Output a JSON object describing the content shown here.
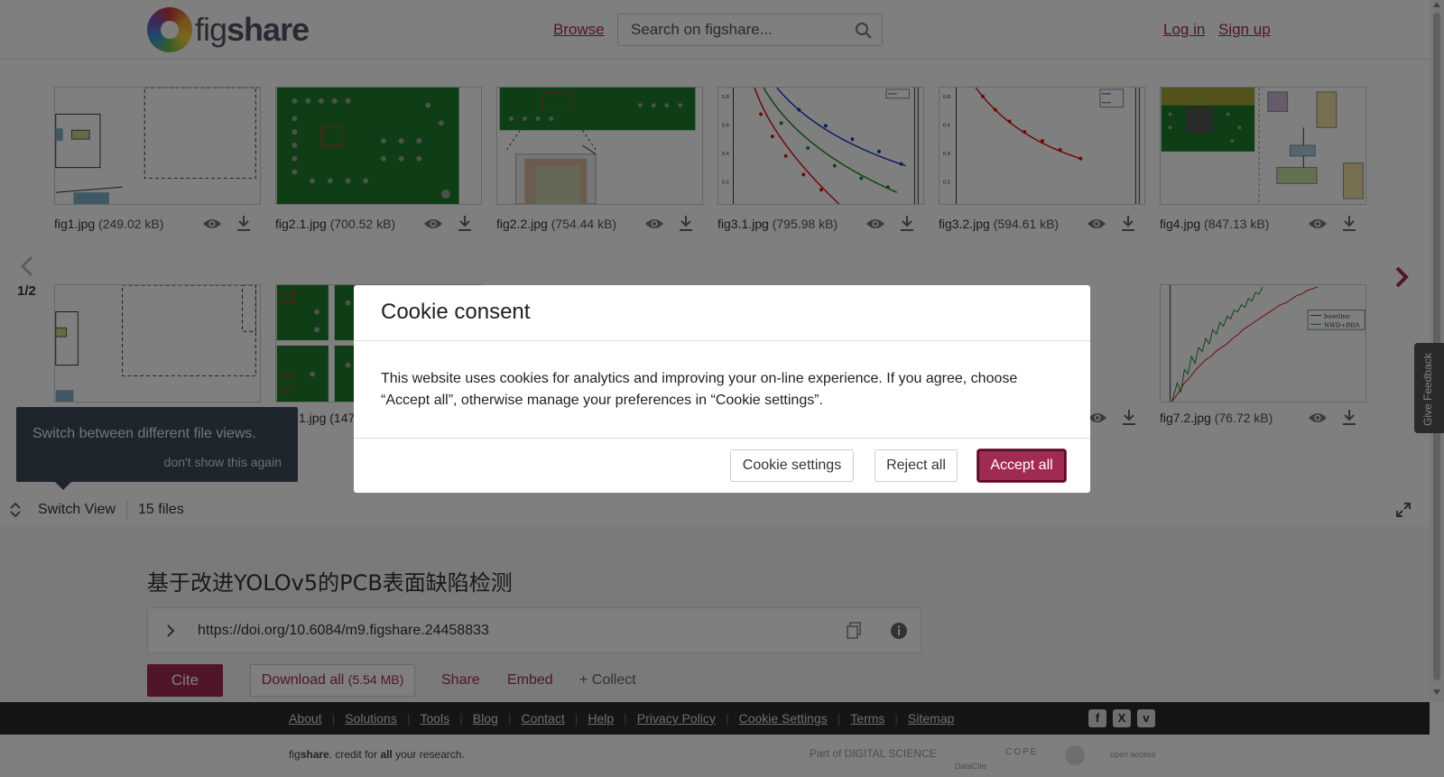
{
  "header": {
    "logo_text_a": "fig",
    "logo_text_b": "share",
    "browse": "Browse",
    "search_placeholder": "Search on figshare...",
    "login": "Log in",
    "signup": "Sign up"
  },
  "gallery": {
    "pager": "1/2",
    "files": [
      {
        "name": "fig1.jpg",
        "size": "(249.02 kB)"
      },
      {
        "name": "fig2.1.jpg",
        "size": "(700.52 kB)"
      },
      {
        "name": "fig2.2.jpg",
        "size": "(754.44 kB)"
      },
      {
        "name": "fig3.1.jpg",
        "size": "(795.98 kB)"
      },
      {
        "name": "fig3.2.jpg",
        "size": "(594.61 kB)"
      },
      {
        "name": "fig4.jpg",
        "size": "(847.13 kB)"
      }
    ],
    "row2_partial": "1.jpg (147",
    "row2_last": {
      "name": "fig7.2.jpg",
      "size": "(76.72 kB)"
    },
    "legend_baseline": "baseline",
    "legend_nwd": "NWD+BRA"
  },
  "tooltip": {
    "text": "Switch between different file views.",
    "dismiss": "don't show this again"
  },
  "viewbar": {
    "switch_label": "Switch View",
    "files_count": "15 files"
  },
  "article": {
    "title": "基于改进YOLOv5的PCB表面缺陷检测",
    "doi": "https://doi.org/10.6084/m9.figshare.24458833",
    "cite": "Cite",
    "download": "Download all",
    "download_size": "(5.54 MB)",
    "share": "Share",
    "embed": "Embed",
    "collect": "+ Collect"
  },
  "footer": {
    "links": [
      "About",
      "Solutions",
      "Tools",
      "Blog",
      "Contact",
      "Help",
      "Privacy Policy",
      "Cookie Settings",
      "Terms",
      "Sitemap"
    ],
    "tagline_a": "fig",
    "tagline_b": "share",
    "tagline_c": ". credit for ",
    "tagline_d": "all",
    "tagline_e": " your research.",
    "partner_ds": "Part of DIGITAL SCIENCE",
    "partner_datacite": "DataCite",
    "partner_cope": "COPE",
    "partner_oa": "open access"
  },
  "feedback": "Give Feedback",
  "cookie": {
    "title": "Cookie consent",
    "body": "This website uses cookies for analytics and improving your on-line experience. If you agree, choose “Accept all”, otherwise manage your preferences in “Cookie settings”.",
    "settings": "Cookie settings",
    "reject": "Reject all",
    "accept": "Accept all"
  },
  "colors": {
    "brand": "#a12a55",
    "pcb_green": "#1f7a2a",
    "tooltip_bg": "#3e4b5b",
    "footer_bg": "#2a2a2a"
  }
}
